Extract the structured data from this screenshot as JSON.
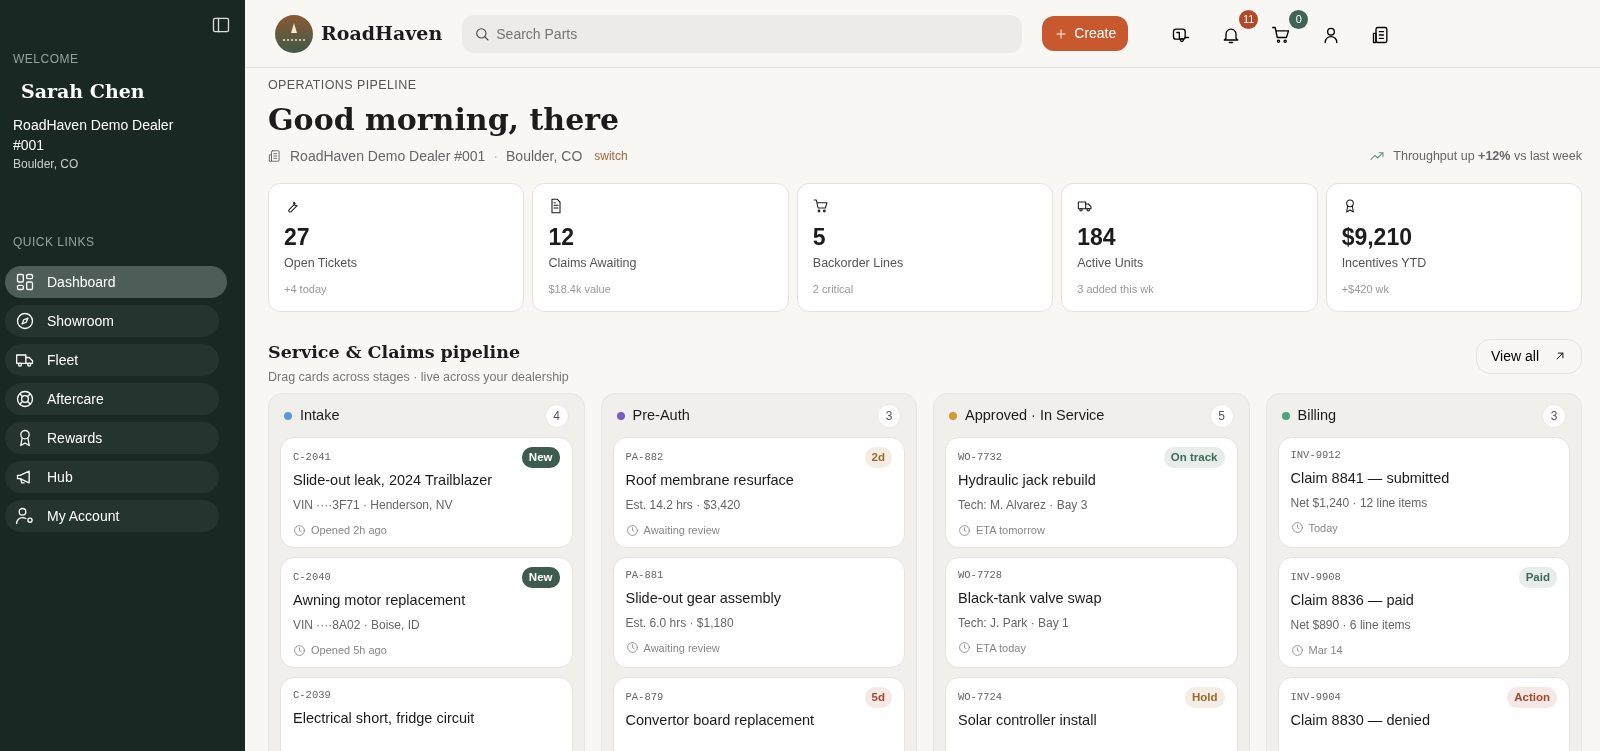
{
  "sidebar": {
    "welcome_label": "WELCOME",
    "user_name": "Sarah Chen",
    "dealer": "RoadHaven Demo Dealer #001",
    "location": "Boulder, CO",
    "quick_links_label": "QUICK LINKS",
    "items": [
      {
        "label": "Dashboard",
        "selected": true
      },
      {
        "label": "Showroom",
        "selected": false
      },
      {
        "label": "Fleet",
        "selected": false
      },
      {
        "label": "Aftercare",
        "selected": false
      },
      {
        "label": "Rewards",
        "selected": false
      },
      {
        "label": "Hub",
        "selected": false
      },
      {
        "label": "My Account",
        "selected": false
      }
    ]
  },
  "topbar": {
    "brand": "RoadHaven",
    "search": {
      "placeholder": "Search Parts"
    },
    "create_button": "Create",
    "notifications_count": "11",
    "cart_count": "0"
  },
  "header": {
    "eyebrow": "OPERATIONS PIPELINE",
    "greeting": "Good morning, there",
    "dealer": "RoadHaven Demo Dealer #001",
    "separator": "·",
    "location": "Boulder, CO",
    "switch_link": "switch",
    "throughput": "Throughput up **+12%** vs last week"
  },
  "kpis": [
    {
      "value": "27",
      "label": "Open Tickets",
      "note": "+4 today"
    },
    {
      "value": "12",
      "label": "Claims Awaiting",
      "note": "$18.4k value"
    },
    {
      "value": "5",
      "label": "Backorder Lines",
      "note": "2 critical"
    },
    {
      "value": "184",
      "label": "Active Units",
      "note": "3 added this wk"
    },
    {
      "value": "$9,210",
      "label": "Incentives YTD",
      "note": "+$420 wk"
    }
  ],
  "pipeline": {
    "title": "Service & Claims pipeline",
    "subtitle": "Drag cards across stages · live across your dealership",
    "view_all": "View all",
    "stages": [
      {
        "name": "Intake",
        "color": "#5b9bd5",
        "count": "4",
        "cards": [
          {
            "id": "C-2041",
            "tag": {
              "label": "New",
              "kind": "solid",
              "color": "#3d5c4f"
            },
            "title": "Slide-out leak, 2024 Trailblazer",
            "meta": "VIN ····3F71 · Henderson, NV",
            "footer": "Opened 2h ago"
          },
          {
            "id": "C-2040",
            "tag": {
              "label": "New",
              "kind": "solid",
              "color": "#3d5c4f"
            },
            "title": "Awning motor replacement",
            "meta": "VIN ····8A02 · Boise, ID",
            "footer": "Opened 5h ago"
          },
          {
            "id": "C-2039",
            "title": "Electrical short, fridge circuit"
          }
        ]
      },
      {
        "name": "Pre-Auth",
        "color": "#7a5cc8",
        "count": "3",
        "cards": [
          {
            "id": "PA-882",
            "tag": {
              "label": "2d",
              "kind": "soft",
              "color": "#9c6a2e"
            },
            "title": "Roof membrane resurface",
            "meta": "Est. 14.2 hrs · $3,420",
            "footer": "Awaiting review"
          },
          {
            "id": "PA-881",
            "title": "Slide-out gear assembly",
            "meta": "Est. 6.0 hrs · $1,180",
            "footer": "Awaiting review"
          },
          {
            "id": "PA-879",
            "tag": {
              "label": "5d",
              "kind": "soft",
              "color": "#a8452f"
            },
            "title": "Convertor board replacement"
          }
        ]
      },
      {
        "name": "Approved · In Service",
        "color": "#d49a3c",
        "count": "5",
        "cards": [
          {
            "id": "WO-7732",
            "tag": {
              "label": "On track",
              "kind": "soft",
              "color": "#3e6a58"
            },
            "title": "Hydraulic jack rebuild",
            "meta": "Tech: M. Alvarez · Bay 3",
            "footer": "ETA tomorrow"
          },
          {
            "id": "WO-7728",
            "title": "Black-tank valve swap",
            "meta": "Tech: J. Park · Bay 1",
            "footer": "ETA today"
          },
          {
            "id": "WO-7724",
            "tag": {
              "label": "Hold",
              "kind": "soft",
              "color": "#9c6a2e"
            },
            "title": "Solar controller install"
          }
        ]
      },
      {
        "name": "Billing",
        "color": "#4fa37c",
        "count": "3",
        "cards": [
          {
            "id": "INV-9912",
            "title": "Claim 8841 — submitted",
            "meta": "Net $1,240 · 12 line items",
            "footer": "Today"
          },
          {
            "id": "INV-9908",
            "tag": {
              "label": "Paid",
              "kind": "soft",
              "color": "#3e6a58"
            },
            "title": "Claim 8836 — paid",
            "meta": "Net $890 · 6 line items",
            "footer": "Mar 14"
          },
          {
            "id": "INV-9904",
            "tag": {
              "label": "Action",
              "kind": "soft",
              "color": "#a8452f"
            },
            "title": "Claim 8830 — denied"
          }
        ]
      }
    ]
  }
}
